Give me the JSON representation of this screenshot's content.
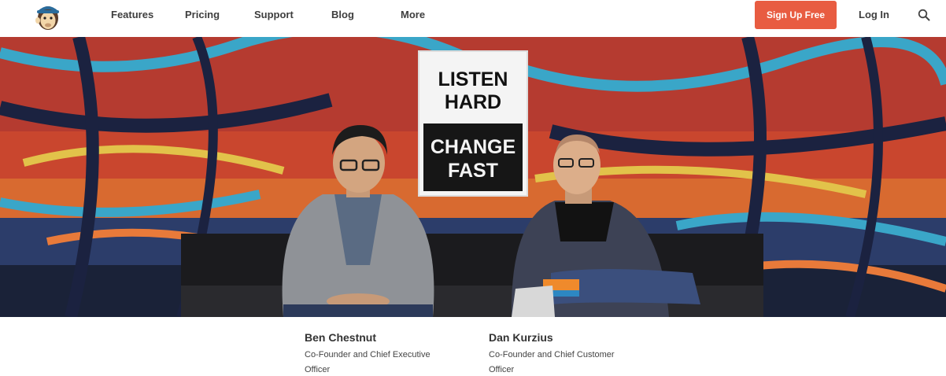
{
  "header": {
    "nav": [
      "Features",
      "Pricing",
      "Support",
      "Blog",
      "More"
    ],
    "signup_label": "Sign Up Free",
    "login_label": "Log In"
  },
  "hero": {
    "sign_top_lines": [
      "LISTEN",
      "HARD"
    ],
    "sign_bottom_lines": [
      "CHANGE",
      "FAST"
    ]
  },
  "people": [
    {
      "name": "Ben Chestnut",
      "role": "Co-Founder and Chief Executive Officer"
    },
    {
      "name": "Dan Kurzius",
      "role": "Co-Founder and Chief Customer Officer"
    }
  ],
  "colors": {
    "accent": "#e85c41",
    "nav_text": "#3e3e3e"
  },
  "icons": [
    "monkey-logo-icon",
    "search-icon"
  ]
}
